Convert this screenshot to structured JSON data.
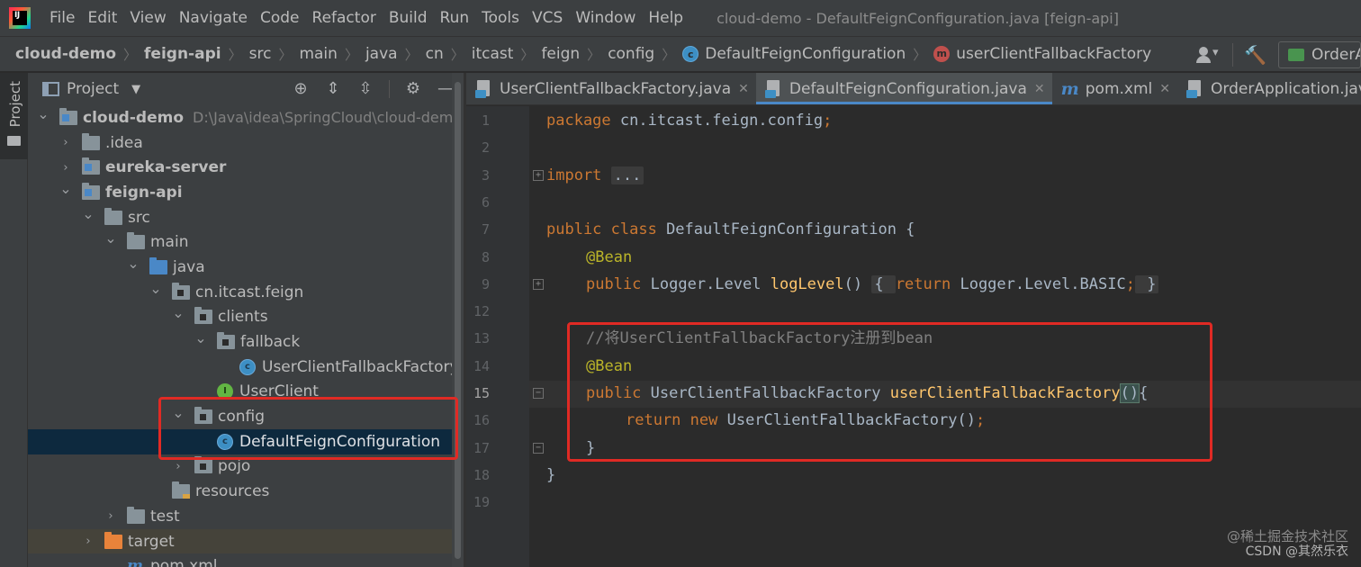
{
  "menubar": {
    "logo_text": "IJ",
    "items": [
      "File",
      "Edit",
      "View",
      "Navigate",
      "Code",
      "Refactor",
      "Build",
      "Run",
      "Tools",
      "VCS",
      "Window",
      "Help"
    ],
    "window_title": "cloud-demo - DefaultFeignConfiguration.java [feign-api]"
  },
  "breadcrumb": {
    "items": [
      "cloud-demo",
      "feign-api",
      "src",
      "main",
      "java",
      "cn",
      "itcast",
      "feign",
      "config",
      "DefaultFeignConfiguration",
      "userClientFallbackFactory"
    ],
    "separator": "〉",
    "class_icon": "c",
    "method_icon": "m",
    "run_config": "OrderA"
  },
  "tool_strip": {
    "project_tab": "Project"
  },
  "project_panel": {
    "title": "Project",
    "tree": [
      {
        "label": "cloud-demo",
        "path": "D:\\Java\\idea\\SpringCloud\\cloud-dem",
        "depth": 0,
        "arrow": "open",
        "icon": "module",
        "bold": true
      },
      {
        "label": ".idea",
        "depth": 1,
        "arrow": "closed",
        "icon": "folder"
      },
      {
        "label": "eureka-server",
        "depth": 1,
        "arrow": "closed",
        "icon": "module",
        "bold": true
      },
      {
        "label": "feign-api",
        "depth": 1,
        "arrow": "open",
        "icon": "module",
        "bold": true
      },
      {
        "label": "src",
        "depth": 2,
        "arrow": "open",
        "icon": "folder"
      },
      {
        "label": "main",
        "depth": 3,
        "arrow": "open",
        "icon": "folder"
      },
      {
        "label": "java",
        "depth": 4,
        "arrow": "open",
        "icon": "source"
      },
      {
        "label": "cn.itcast.feign",
        "depth": 5,
        "arrow": "open",
        "icon": "package"
      },
      {
        "label": "clients",
        "depth": 6,
        "arrow": "open",
        "icon": "package"
      },
      {
        "label": "fallback",
        "depth": 7,
        "arrow": "open",
        "icon": "package"
      },
      {
        "label": "UserClientFallbackFactory",
        "depth": 8,
        "arrow": "none",
        "icon": "class"
      },
      {
        "label": "UserClient",
        "depth": 7,
        "arrow": "none",
        "icon": "interface"
      },
      {
        "label": "config",
        "depth": 6,
        "arrow": "open",
        "icon": "package"
      },
      {
        "label": "DefaultFeignConfiguration",
        "depth": 7,
        "arrow": "none",
        "icon": "class",
        "selected": true
      },
      {
        "label": "pojo",
        "depth": 6,
        "arrow": "closed",
        "icon": "package"
      },
      {
        "label": "resources",
        "depth": 5,
        "arrow": "none",
        "icon": "resource"
      },
      {
        "label": "test",
        "depth": 3,
        "arrow": "closed",
        "icon": "folder"
      },
      {
        "label": "target",
        "depth": 2,
        "arrow": "closed",
        "icon": "excluded",
        "highlighted": true
      },
      {
        "label": "pom.xml",
        "depth": 3,
        "arrow": "none",
        "icon": "maven"
      }
    ]
  },
  "tabs": [
    {
      "label": "UserClientFallbackFactory.java",
      "icon": "class",
      "active": false
    },
    {
      "label": "DefaultFeignConfiguration.java",
      "icon": "class",
      "active": true
    },
    {
      "label": "pom.xml",
      "icon": "maven",
      "active": false
    },
    {
      "label": "OrderApplication.java",
      "icon": "class",
      "active": false
    }
  ],
  "tab_close": "✕",
  "editor": {
    "line_numbers": [
      "1",
      "2",
      "3",
      "6",
      "7",
      "8",
      "9",
      "12",
      "13",
      "14",
      "15",
      "16",
      "17",
      "18",
      "19"
    ],
    "current_line": "15",
    "code": [
      {
        "no": "1",
        "indent": 0,
        "tokens": [
          [
            "kw",
            "package "
          ],
          [
            "",
            "cn.itcast.feign.config"
          ],
          [
            "kw",
            ";"
          ]
        ]
      },
      {
        "no": "2",
        "indent": 0,
        "tokens": []
      },
      {
        "no": "3",
        "indent": 0,
        "tokens": [
          [
            "kw",
            "import "
          ],
          [
            "folded",
            "..."
          ]
        ]
      },
      {
        "no": "6",
        "indent": 0,
        "tokens": []
      },
      {
        "no": "7",
        "indent": 0,
        "tokens": [
          [
            "kw",
            "public class "
          ],
          [
            "",
            "DefaultFeignConfiguration {"
          ]
        ]
      },
      {
        "no": "8",
        "indent": 1,
        "tokens": [
          [
            "ann",
            "@Bean"
          ]
        ]
      },
      {
        "no": "9",
        "indent": 1,
        "tokens": [
          [
            "kw",
            "public "
          ],
          [
            "",
            "Logger.Level "
          ],
          [
            "method-name",
            "logLevel"
          ],
          [
            "",
            "() "
          ],
          [
            "folded",
            "{ "
          ],
          [
            "kw",
            "return "
          ],
          [
            "",
            "Logger.Level."
          ],
          [
            "",
            "BASIC"
          ],
          [
            "kw",
            ";"
          ],
          [
            "folded",
            " }"
          ]
        ]
      },
      {
        "no": "12",
        "indent": 0,
        "tokens": []
      },
      {
        "no": "13",
        "indent": 1,
        "tokens": [
          [
            "cmt",
            "//将UserClientFallbackFactory注册到bean"
          ]
        ]
      },
      {
        "no": "14",
        "indent": 1,
        "tokens": [
          [
            "ann",
            "@Bean"
          ]
        ]
      },
      {
        "no": "15",
        "indent": 1,
        "tokens": [
          [
            "kw",
            "public "
          ],
          [
            "",
            "UserClientFallbackFactory "
          ],
          [
            "method-name",
            "userClientFallbackFactory"
          ],
          [
            "brace-match",
            "()"
          ],
          [
            "",
            "{"
          ]
        ]
      },
      {
        "no": "16",
        "indent": 2,
        "tokens": [
          [
            "kw",
            "return new "
          ],
          [
            "",
            "UserClientFallbackFactory()"
          ],
          [
            "kw",
            ";"
          ]
        ]
      },
      {
        "no": "17",
        "indent": 1,
        "tokens": [
          [
            "",
            "}"
          ]
        ]
      },
      {
        "no": "18",
        "indent": 0,
        "tokens": [
          [
            "",
            "}"
          ]
        ]
      },
      {
        "no": "19",
        "indent": 0,
        "tokens": []
      }
    ]
  },
  "colors": {
    "highlight_border": "#e02a24",
    "selection": "#0d293e",
    "accent": "#4a88c7"
  },
  "watermark": {
    "top": "@稀土掘金技术社区",
    "bottom": "CSDN @其然乐衣"
  }
}
